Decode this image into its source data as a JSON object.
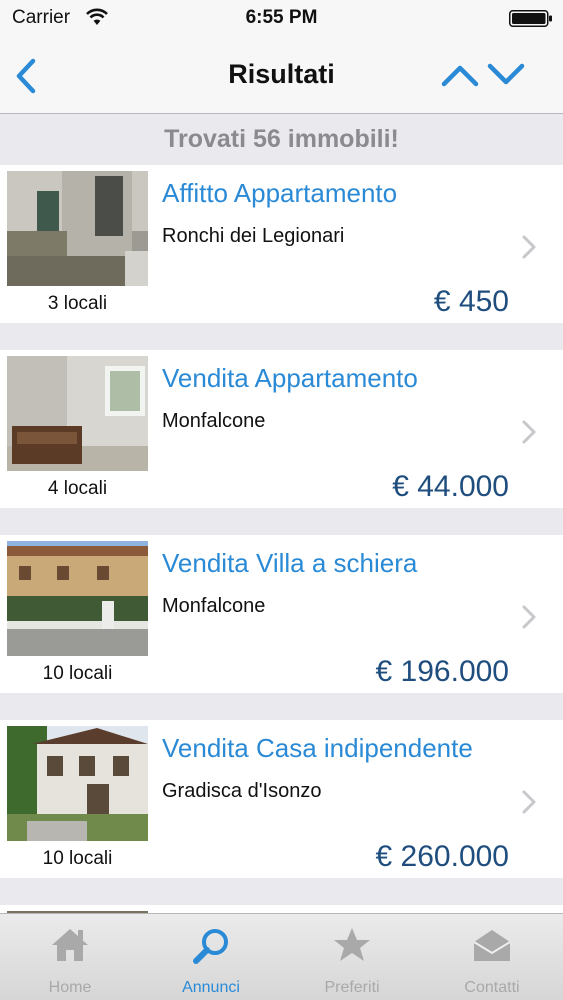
{
  "status_bar": {
    "carrier": "Carrier",
    "time": "6:55 PM"
  },
  "nav": {
    "title": "Risultati"
  },
  "results": {
    "count_text": "Trovati 56 immobili!"
  },
  "listings": [
    {
      "title": "Affitto Appartamento",
      "city": "Ronchi dei Legionari",
      "rooms": "3 locali",
      "price": "€ 450"
    },
    {
      "title": "Vendita Appartamento",
      "city": "Monfalcone",
      "rooms": "4 locali",
      "price": "€ 44.000"
    },
    {
      "title": "Vendita Villa a schiera",
      "city": "Monfalcone",
      "rooms": "10 locali",
      "price": "€ 196.000"
    },
    {
      "title": "Vendita Casa indipendente",
      "city": "Gradisca d'Isonzo",
      "rooms": "10 locali",
      "price": "€ 260.000"
    }
  ],
  "tabs": [
    {
      "label": "Home",
      "icon": "home-icon"
    },
    {
      "label": "Annunci",
      "icon": "magnifier-icon",
      "active": true
    },
    {
      "label": "Preferiti",
      "icon": "star-icon"
    },
    {
      "label": "Contatti",
      "icon": "envelope-icon"
    }
  ],
  "colors": {
    "accent": "#2a8ad6",
    "price": "#1f4e7e",
    "inactive_tab": "#a9a9a9"
  }
}
